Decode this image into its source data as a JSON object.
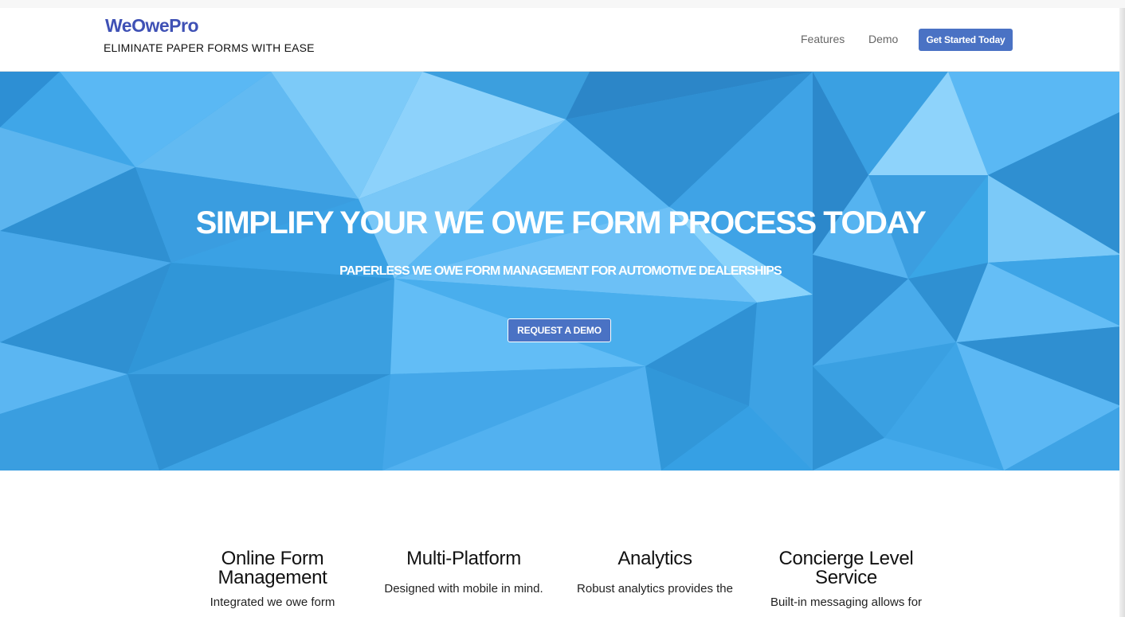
{
  "brand": {
    "name": "WeOwePro",
    "tagline": "ELIMINATE PAPER FORMS WITH EASE",
    "color": "#3f51b5"
  },
  "nav": {
    "features": "Features",
    "demo": "Demo",
    "cta": "Get Started Today"
  },
  "hero": {
    "title": "SIMPLIFY YOUR WE OWE FORM PROCESS TODAY",
    "subtitle": "PAPERLESS WE OWE FORM MANAGEMENT FOR AUTOMOTIVE DEALERSHIPS",
    "button": "REQUEST A DEMO"
  },
  "features": [
    {
      "title": "Online Form Management",
      "text": "Integrated we owe form"
    },
    {
      "title": "Multi-Platform",
      "text": "Designed with mobile in mind."
    },
    {
      "title": "Analytics",
      "text": "Robust analytics provides the"
    },
    {
      "title": "Concierge Level Service",
      "text": "Built-in messaging allows for"
    }
  ],
  "colors": {
    "accent": "#4a72c4",
    "hero_blue": "#3aa6e6"
  }
}
